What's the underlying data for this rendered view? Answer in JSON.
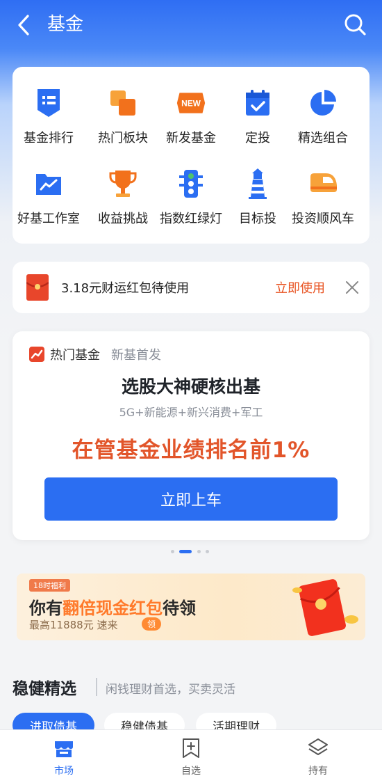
{
  "header": {
    "title": "基金"
  },
  "menu": {
    "items": [
      {
        "label": "基金排行",
        "icon": "ranking-list-icon"
      },
      {
        "label": "热门板块",
        "icon": "hot-sector-icon"
      },
      {
        "label": "新发基金",
        "icon": "new-badge-icon"
      },
      {
        "label": "定投",
        "icon": "calendar-check-icon"
      },
      {
        "label": "精选组合",
        "icon": "pie-chart-icon"
      },
      {
        "label": "好基工作室",
        "icon": "trend-folder-icon"
      },
      {
        "label": "收益挑战",
        "icon": "trophy-icon"
      },
      {
        "label": "指数红绿灯",
        "icon": "traffic-light-icon"
      },
      {
        "label": "目标投",
        "icon": "lighthouse-icon"
      },
      {
        "label": "投资顺风车",
        "icon": "train-icon"
      }
    ]
  },
  "coupon": {
    "text": "3.18元财运红包待使用",
    "action": "立即使用"
  },
  "promo": {
    "tag": "热门基金",
    "tag_sub": "新基首发",
    "title": "选股大神硬核出基",
    "subtitle": "5G+新能源+新兴消费+军工",
    "highlight": "在管基金业绩排名前1%",
    "button": "立即上车"
  },
  "banner": {
    "badge": "18时福利",
    "title_prefix": "你有",
    "title_highlight": "翻倍现金红包",
    "title_suffix": "待领",
    "subtitle": "最高11888元 速来",
    "pill": "领"
  },
  "section": {
    "title": "稳健精选",
    "subtitle": "闲钱理财首选，买卖灵活",
    "chips": [
      "进取债基",
      "稳健债基",
      "活期理财"
    ]
  },
  "tabbar": {
    "items": [
      {
        "label": "市场",
        "icon": "store-icon",
        "active": true
      },
      {
        "label": "自选",
        "icon": "add-bookmark-icon",
        "active": false
      },
      {
        "label": "持有",
        "icon": "layers-icon",
        "active": false
      }
    ]
  },
  "colors": {
    "accent": "#2b6ef2",
    "highlight": "#e2552a",
    "coupon": "#e8511f"
  }
}
